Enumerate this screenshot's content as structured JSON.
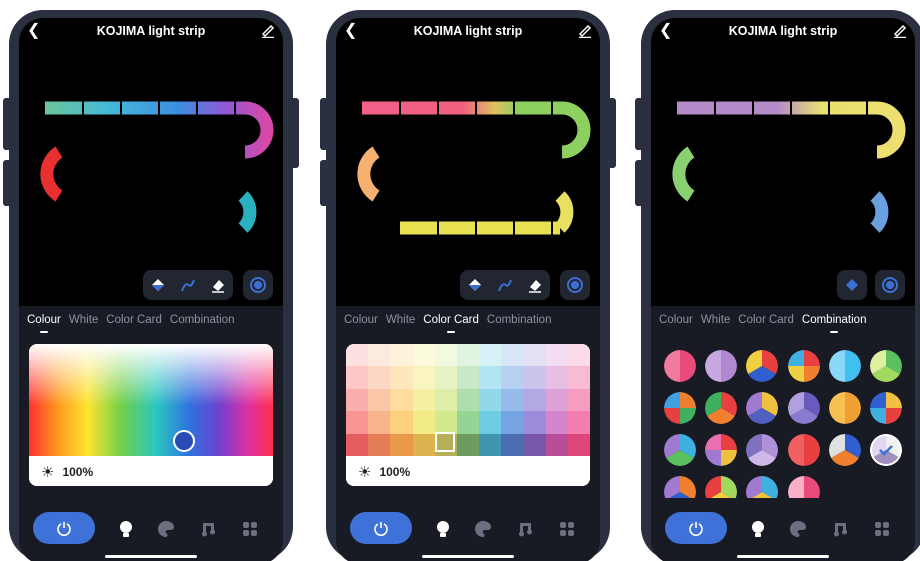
{
  "phones": [
    {
      "title": "KOJIMA light strip",
      "tabs": [
        "Colour",
        "White",
        "Color Card",
        "Combination"
      ],
      "active_tab": 0,
      "brightness": "100%"
    },
    {
      "title": "KOJIMA light strip",
      "tabs": [
        "Colour",
        "White",
        "Color Card",
        "Combination"
      ],
      "active_tab": 2,
      "brightness": "100%"
    },
    {
      "title": "KOJIMA light strip",
      "tabs": [
        "Colour",
        "White",
        "Color Card",
        "Combination"
      ],
      "active_tab": 3
    }
  ],
  "icons": {
    "back": "chevron-left-icon",
    "edit": "pencil-icon",
    "tools": [
      "paint-bucket-icon",
      "brush-icon",
      "eraser-icon",
      "target-icon"
    ],
    "nav": [
      "power-icon",
      "bulb-icon",
      "palette-icon",
      "music-icon",
      "grid-icon"
    ]
  },
  "colors": {
    "accent": "#3e72d9",
    "panel": "#181b24",
    "frame": "#2b3040"
  }
}
